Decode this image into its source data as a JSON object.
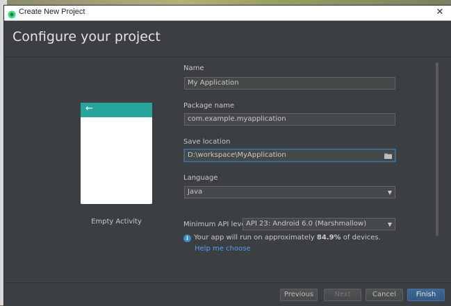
{
  "window": {
    "title": "Create New Project",
    "close_glyph": "✕",
    "heading": "Configure your project"
  },
  "preview": {
    "back_glyph": "←",
    "activity_label": "Empty Activity",
    "accent_color": "#26a69a"
  },
  "form": {
    "name": {
      "label": "Name",
      "value": "My Application"
    },
    "package": {
      "label": "Package name",
      "value": "com.example.myapplication"
    },
    "save_location": {
      "label": "Save location",
      "value": "D:\\workspace\\MyApplication"
    },
    "language": {
      "label": "Language",
      "value": "Java"
    },
    "min_api": {
      "label": "Minimum API level",
      "value": "API 23: Android 6.0 (Marshmallow)"
    },
    "info_prefix": "Your app will run on approximately ",
    "info_percent": "84.9%",
    "info_suffix": " of devices.",
    "help_link": "Help me choose"
  },
  "footer": {
    "previous": "Previous",
    "next": "Next",
    "cancel": "Cancel",
    "finish": "Finish"
  },
  "colors": {
    "background": "#3c3f41",
    "link": "#589df6",
    "primary_button": "#365880"
  },
  "icons": {
    "app": "android-studio-icon",
    "close": "close-icon",
    "folder": "folder-icon",
    "info": "info-icon",
    "caret": "chevron-down-icon"
  }
}
